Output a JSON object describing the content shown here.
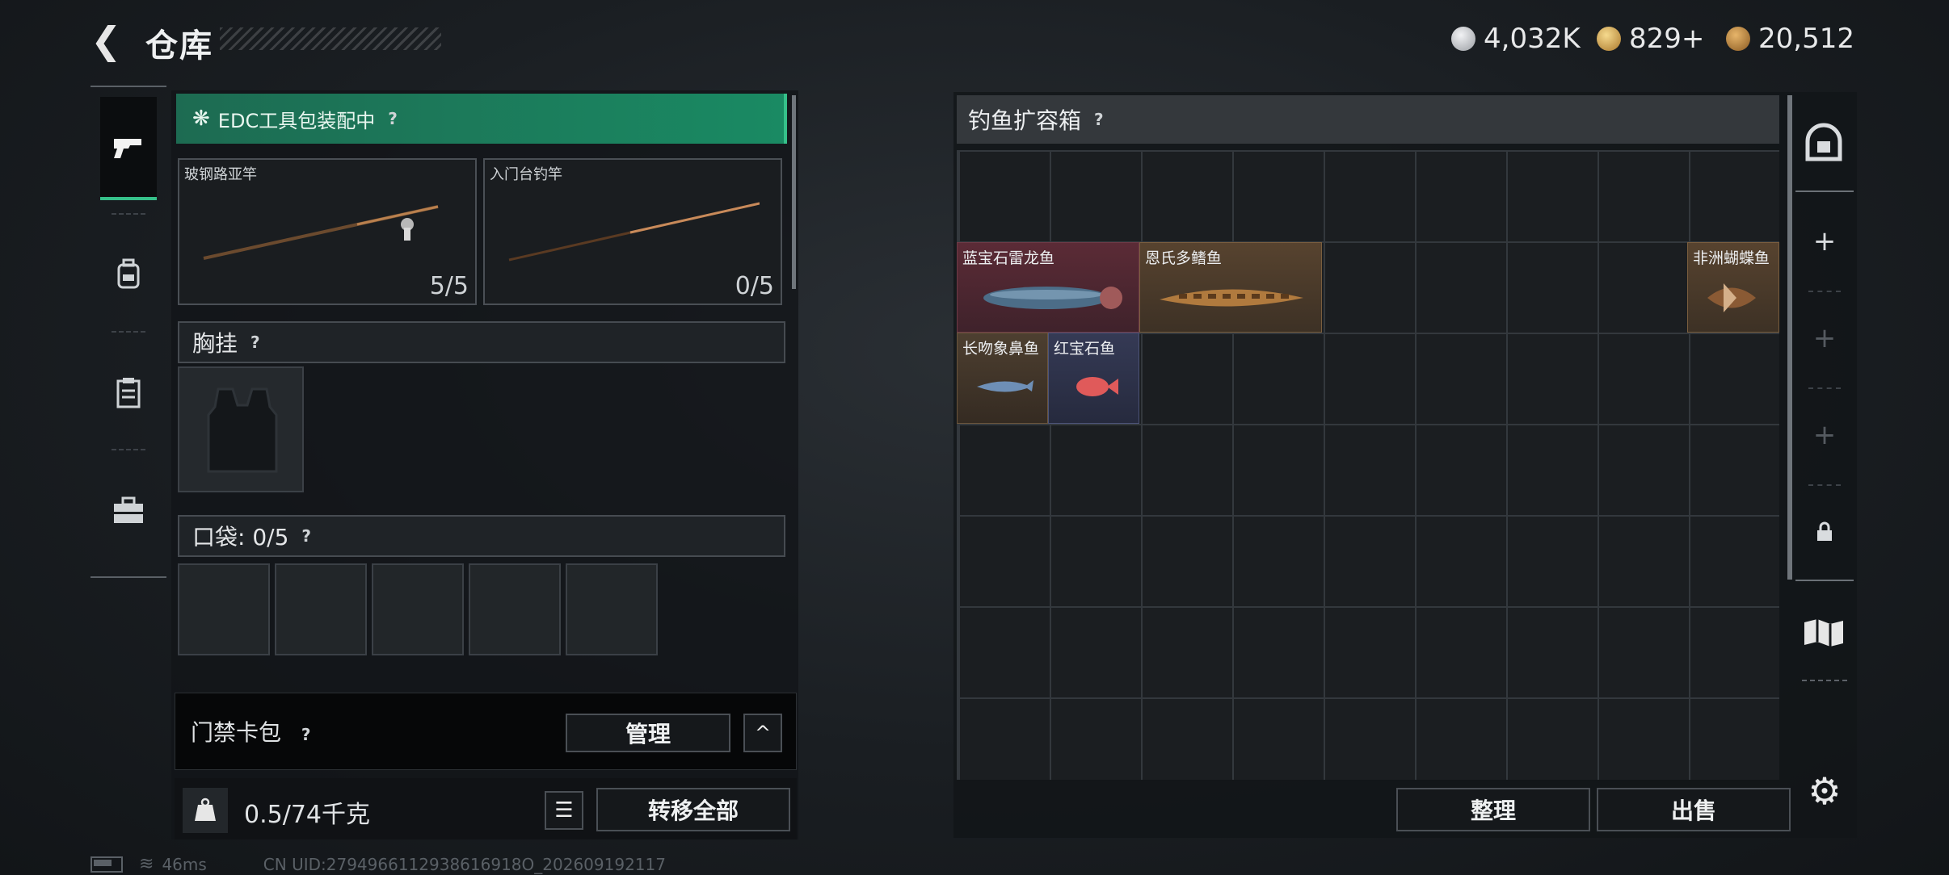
{
  "header": {
    "title": "仓库",
    "back_icon": "back-arrow-icon"
  },
  "currency": [
    {
      "icon": "silver-coin-icon",
      "value": "4,032K",
      "color": "#c9ccd0"
    },
    {
      "icon": "gold-token-icon",
      "value": "829+",
      "color": "#d9a94a"
    },
    {
      "icon": "bronze-coin-icon",
      "value": "20,512",
      "color": "#b88a3c"
    }
  ],
  "left_tabs": [
    {
      "icon": "pistol-icon",
      "active": true
    },
    {
      "icon": "backpack-icon",
      "active": false
    },
    {
      "icon": "clipboard-icon",
      "active": false
    },
    {
      "icon": "toolbox-icon",
      "active": false
    }
  ],
  "edc": {
    "label": "EDC工具包装配中",
    "help": "?"
  },
  "rods": [
    {
      "name": "玻钢路亚竿",
      "count": "5/5"
    },
    {
      "name": "入门台钓竿",
      "count": "0/5"
    }
  ],
  "chest": {
    "label": "胸挂",
    "help": "?"
  },
  "pocket": {
    "label": "口袋: 0/5",
    "help": "?"
  },
  "keycard": {
    "label": "门禁卡包",
    "help": "?",
    "manage": "管理",
    "toggle": "^"
  },
  "footer_left": {
    "weight": "0.5/74千克",
    "transfer": "转移全部"
  },
  "container": {
    "title": "钓鱼扩容箱",
    "help": "?",
    "fish": [
      {
        "name": "蓝宝石雷龙鱼"
      },
      {
        "name": "恩氏多鳍鱼"
      },
      {
        "name": "非洲蝴蝶鱼"
      },
      {
        "name": "长吻象鼻鱼"
      },
      {
        "name": "红宝石鱼"
      }
    ],
    "sort": "整理",
    "sell": "出售"
  },
  "right_rail": {
    "plus": "+",
    "lock_icon": "lock-icon",
    "map_icon": "map-icon",
    "settings_icon": "gear-icon"
  },
  "status": {
    "ping": "46ms",
    "uid": "CN UID:2794966112938616918O_202609192117"
  },
  "colors": {
    "accent_green": "#36c08a",
    "edc_bg": "#1a8a63"
  }
}
